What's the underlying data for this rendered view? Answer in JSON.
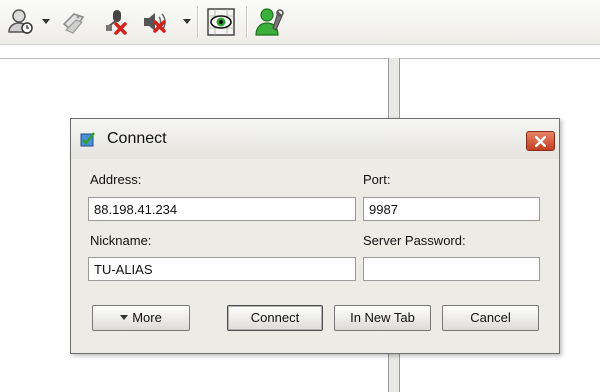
{
  "toolbar": {
    "icons": [
      "connect-user-icon",
      "bookmark-icon",
      "disconnect-mic-icon",
      "mute-speaker-icon",
      "view-eye-icon",
      "user-settings-icon"
    ]
  },
  "dialog": {
    "title": "Connect",
    "address_label": "Address:",
    "address_value": "88.198.41.234",
    "port_label": "Port:",
    "port_value": "9987",
    "nickname_label": "Nickname:",
    "nickname_value": "TU-ALIAS",
    "password_label": "Server Password:",
    "password_value": "",
    "more_label": "More",
    "connect_label": "Connect",
    "new_tab_label": "In New Tab",
    "cancel_label": "Cancel"
  },
  "colors": {
    "close_button": "#c3401f",
    "dialog_bg": "#ecebe6",
    "toolbar_bg": "#eeede8"
  }
}
